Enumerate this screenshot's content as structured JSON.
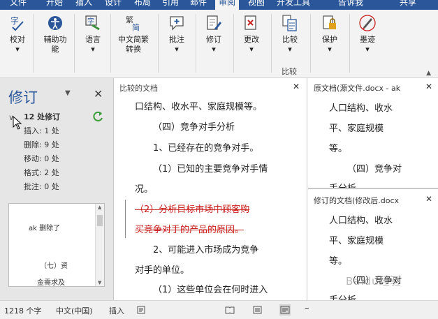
{
  "tabs": [
    "文件",
    "开始",
    "插入",
    "设计",
    "布局",
    "引用",
    "邮件",
    "审阅",
    "视图",
    "开发工具",
    "告诉我",
    "共享"
  ],
  "active_tab": "审阅",
  "ribbon": {
    "proofing": "校对",
    "accessibility": "辅助功能",
    "language": "语言",
    "chinese_convert": "中文简繁转换",
    "comments": "批注",
    "tracking": "修订",
    "changes": "更改",
    "compare": "比较",
    "compare_group": "比较",
    "protect": "保护",
    "ink": "墨迹"
  },
  "revisions_pane": {
    "title": "修订",
    "summary": "12 处修订",
    "stats": [
      "插入: 1 处",
      "删除: 9 处",
      "移动: 0 处",
      "格式: 2 处",
      "批注: 0 处"
    ],
    "list": {
      "author_action": "ak 删除了",
      "line1": "（七）资",
      "line2": "金需求及"
    }
  },
  "compared_doc": {
    "title": "比较的文档",
    "lines": [
      "口结构、收水平、家庭规模等。",
      "（四）竞争对手分析",
      "1、已经存在的竞争对手。",
      "（1）已知的主要竞争对手情",
      "况。",
      "（2）分析目标市场中顾客购",
      "买竞争对手的产品的原因。",
      "2、可能进入市场成为竞争",
      "对手的单位。",
      "（1）这些单位会在何时进入"
    ]
  },
  "original_doc": {
    "title": "原文档(源文件.docx - ak",
    "lines": [
      "人口结构、收水",
      "平、家庭规模",
      "等。",
      "（四）竞争对",
      "手分析"
    ]
  },
  "revised_doc": {
    "title": "修订的文档(修改后.docx",
    "lines": [
      "人口结构、收水",
      "平、家庭规模",
      "等。",
      "（四）竞争对",
      "手分析"
    ]
  },
  "statusbar": {
    "word_count": "1218 个字",
    "language": "中文(中国)",
    "mode": "插入"
  },
  "watermark": "Baidu经验",
  "colors": {
    "accent": "#2b579a",
    "deletion": "#c8201c"
  }
}
